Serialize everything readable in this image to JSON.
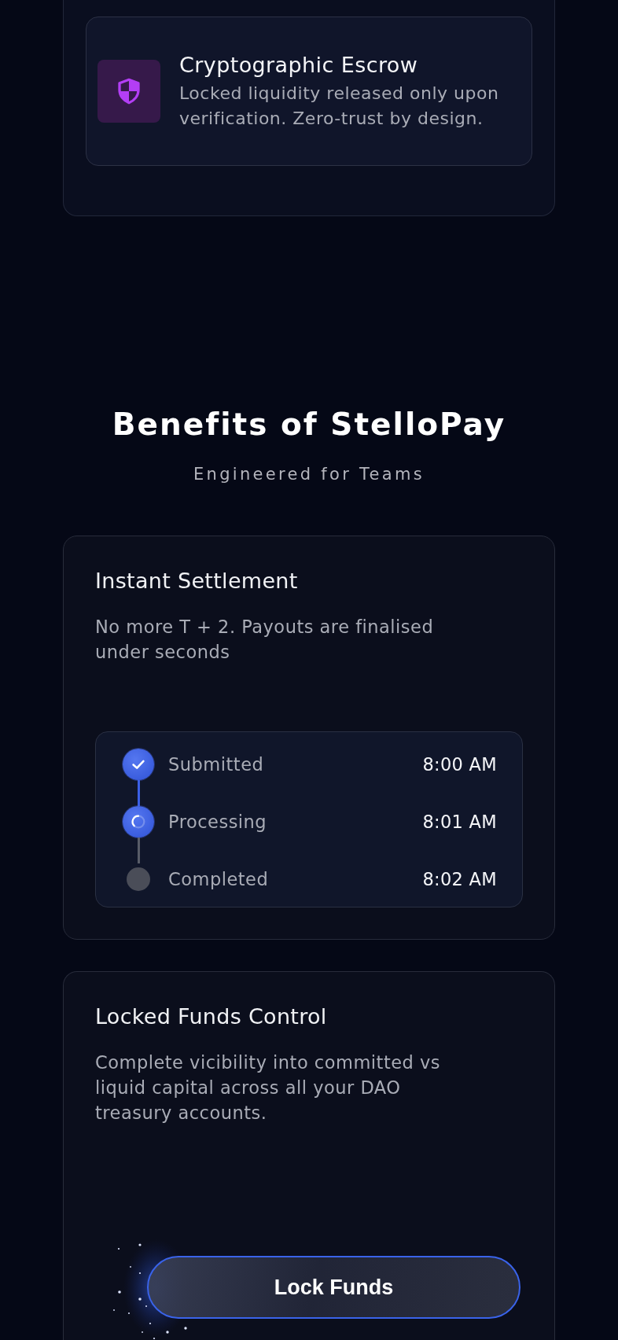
{
  "feature_card": {
    "title": "Cryptographic Escrow",
    "description": "Locked liquidity released only upon verification. Zero-trust by design."
  },
  "section": {
    "title": "Benefits of StelloPay",
    "subtitle": "Engineered for Teams"
  },
  "benefits": [
    {
      "kind": "timeline",
      "title": "Instant Settlement",
      "description": "No more T + 2. Payouts are finalised under seconds",
      "steps": [
        {
          "label": "Submitted",
          "time": "8:00 AM",
          "completed": true,
          "in_progress": false
        },
        {
          "label": "Processing",
          "time": "8:01 AM",
          "completed": false,
          "in_progress": true
        },
        {
          "label": "Completed",
          "time": "8:02 AM",
          "completed": false,
          "in_progress": false
        }
      ]
    },
    {
      "kind": "action",
      "title": "Locked Funds Control",
      "description": "Complete vicibility into committed vs liquid capital across all your DAO treasury accounts.",
      "button": "Lock Funds"
    }
  ]
}
